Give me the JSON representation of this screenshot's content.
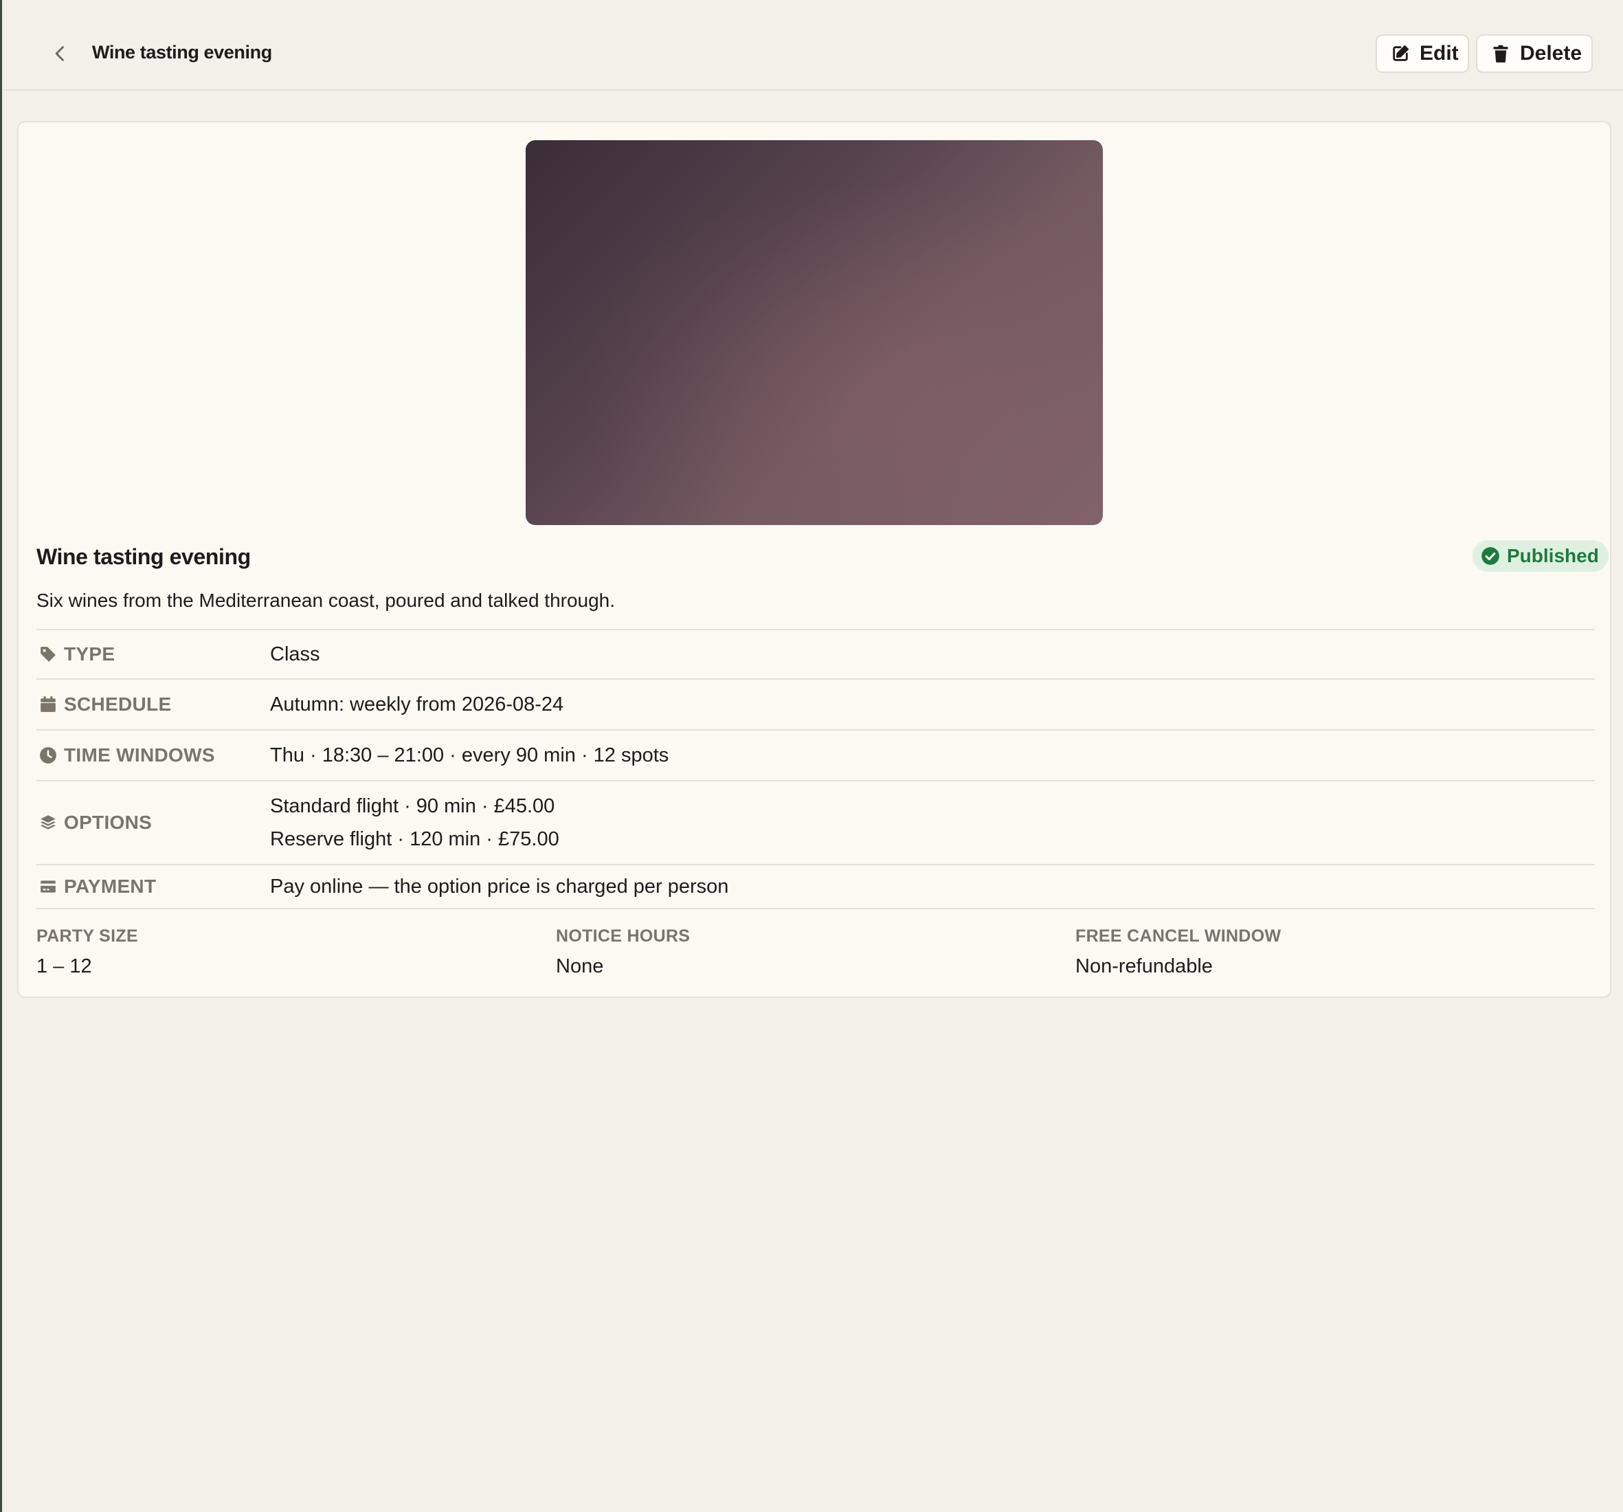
{
  "header": {
    "title": "Wine tasting evening",
    "edit_label": "Edit",
    "delete_label": "Delete"
  },
  "event": {
    "title": "Wine tasting evening",
    "status": "Published",
    "description": "Six wines from the Mediterranean coast, poured and talked through."
  },
  "details": {
    "type": {
      "label": "TYPE",
      "value": "Class",
      "icon": "tag-icon"
    },
    "schedule": {
      "label": "SCHEDULE",
      "value": "Autumn: weekly from 2026-08-24",
      "icon": "calendar-icon"
    },
    "time_windows": {
      "label": "TIME WINDOWS",
      "value": "Thu · 18:30 – 21:00 · every 90 min · 12 spots",
      "icon": "clock-icon"
    },
    "options": {
      "label": "OPTIONS",
      "icon": "layers-icon",
      "items": [
        "Standard flight · 90 min · £45.00",
        "Reserve flight · 120 min · £75.00"
      ]
    },
    "payment": {
      "label": "PAYMENT",
      "value": "Pay online — the option price is charged per person",
      "icon": "credit-card-icon"
    }
  },
  "stats": [
    {
      "label": "PARTY SIZE",
      "value": "1 – 12"
    },
    {
      "label": "NOTICE HOURS",
      "value": "None"
    },
    {
      "label": "FREE CANCEL WINDOW",
      "value": "Non-refundable"
    }
  ],
  "colors": {
    "background": "#f3efe9",
    "card": "#fcf9f3",
    "status_green": "#1f7a3e",
    "status_bg": "#dff0e1",
    "muted_label": "#7a746a"
  }
}
